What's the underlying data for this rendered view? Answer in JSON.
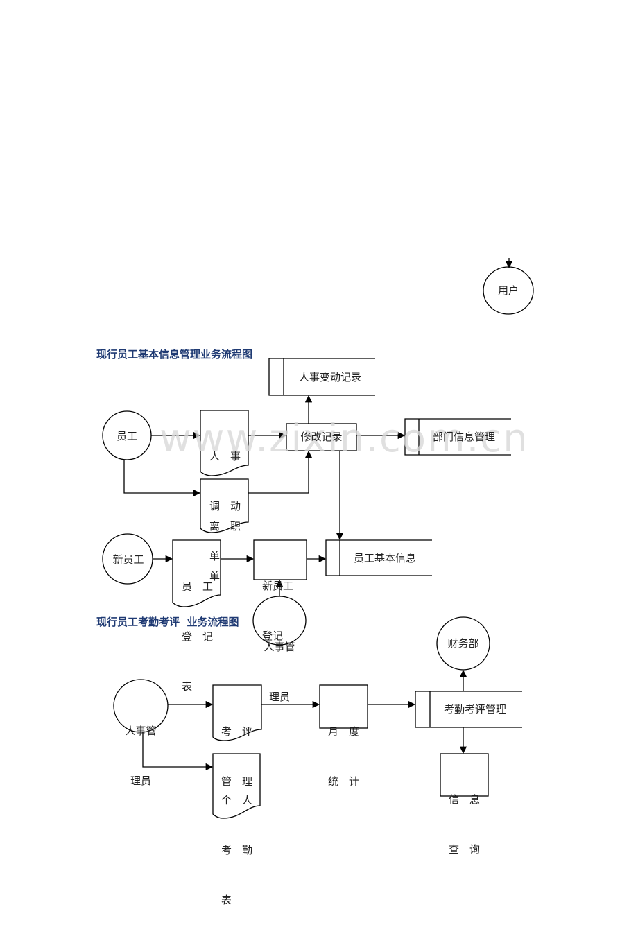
{
  "watermark": "www.zixin.com.cn",
  "diagram1": {
    "title": "现行员工基本信息管理业务流程图",
    "nodes": {
      "user": "用户",
      "employee": "员工",
      "personnel_change_form": [
        "人　事",
        "调　动",
        "单"
      ],
      "resignation_form": [
        "离　职",
        "单"
      ],
      "modify_record": "修改记录",
      "personnel_change_record": "人事变动记录",
      "dept_info_mgmt": "部门信息管理",
      "new_employee": "新员工",
      "employee_reg_form": [
        "员　工",
        "登　记",
        "表"
      ],
      "new_employee_reg": [
        "新员工",
        "登记"
      ],
      "hr_admin": [
        "人事管",
        "理员"
      ],
      "employee_basic_info": "员工基本信息"
    }
  },
  "diagram2": {
    "title": "现行员工考勤考评  业务流程图",
    "nodes": {
      "hr_admin": [
        "人事管",
        "理员"
      ],
      "evaluation_mgmt": [
        "考　评",
        "管　理"
      ],
      "personal_attendance": [
        "个　人",
        "考　勤",
        "表"
      ],
      "monthly_stats": [
        "月　度",
        "统　计"
      ],
      "attendance_eval_mgmt": "考勤考评管理",
      "finance_dept": "财务部",
      "info_query": [
        "信　息",
        "查　询"
      ]
    }
  }
}
